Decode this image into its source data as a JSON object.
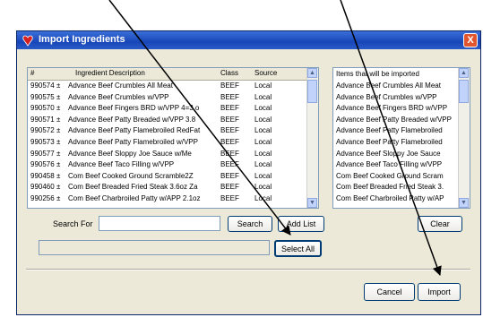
{
  "window": {
    "title": "Import Ingredients",
    "close_label": "X"
  },
  "left_list": {
    "headers": {
      "number": "#",
      "description": "Ingredient Description",
      "class": "Class",
      "source": "Source"
    },
    "rows": [
      {
        "number": "990574",
        "flag": "±",
        "description": "Advance Beef Crumbles All Meat",
        "class": "BEEF",
        "source": "Local"
      },
      {
        "number": "990575",
        "flag": "±",
        "description": "Advance Beef Crumbles w/VPP",
        "class": "BEEF",
        "source": "Local"
      },
      {
        "number": "990570",
        "flag": "±",
        "description": "Advance Beef Fingers BRD w/VPP 4=3 o",
        "class": "BEEF",
        "source": "Local"
      },
      {
        "number": "990571",
        "flag": "±",
        "description": "Advance Beef Patty Breaded w/VPP 3.8",
        "class": "BEEF",
        "source": "Local"
      },
      {
        "number": "990572",
        "flag": "±",
        "description": "Advance Beef Patty Flamebroiled RedFat",
        "class": "BEEF",
        "source": "Local"
      },
      {
        "number": "990573",
        "flag": "±",
        "description": "Advance Beef Patty Flamebroiled w/VPP",
        "class": "BEEF",
        "source": "Local"
      },
      {
        "number": "990577",
        "flag": "±",
        "description": "Advance Beef Sloppy Joe Sauce w/Me",
        "class": "BEEF",
        "source": "Local"
      },
      {
        "number": "990576",
        "flag": "±",
        "description": "Advance Beef Taco Filling w/VPP",
        "class": "BEEF",
        "source": "Local"
      },
      {
        "number": "990458",
        "flag": "±",
        "description": "Com Beef  Cooked Ground Scramble2Z",
        "class": "BEEF",
        "source": "Local"
      },
      {
        "number": "990460",
        "flag": "±",
        "description": "Com Beef Breaded Fried Steak 3.6oz Za",
        "class": "BEEF",
        "source": "Local"
      },
      {
        "number": "990256",
        "flag": "±",
        "description": "Com Beef Charbroiled Patty w/APP 2.1oz",
        "class": "BEEF",
        "source": "Local"
      }
    ]
  },
  "right_list": {
    "header": "Items that will be imported",
    "rows": [
      "Advance Beef Crumbles All Meat",
      "Advance Beef Crumbles w/VPP",
      "Advance Beef Fingers BRD w/VPP",
      "Advance Beef Patty Breaded w/VPP",
      "Advance Beef Patty Flamebroiled",
      "Advance Beef Patty Flamebroiled",
      "Advance Beef Sloppy Joe Sauce",
      "Advance Beef Taco Filling w/VPP",
      "Com Beef  Cooked Ground Scram",
      "Com Beef Breaded Fried Steak 3.",
      "Com Beef Charbroiled Patty w/AP"
    ]
  },
  "search": {
    "label": "Search For",
    "value": ""
  },
  "buttons": {
    "search": "Search",
    "add_list": "Add List",
    "select_all": "Select All",
    "clear": "Clear",
    "cancel": "Cancel",
    "import": "Import"
  },
  "icons": {
    "window": "ingredients-app-icon",
    "scroll_up": "chevron-up-icon",
    "scroll_down": "chevron-down-icon"
  },
  "colors": {
    "titlebar": "#2a5cc8",
    "close": "#e0542e",
    "dialog_bg": "#ece9d8"
  }
}
